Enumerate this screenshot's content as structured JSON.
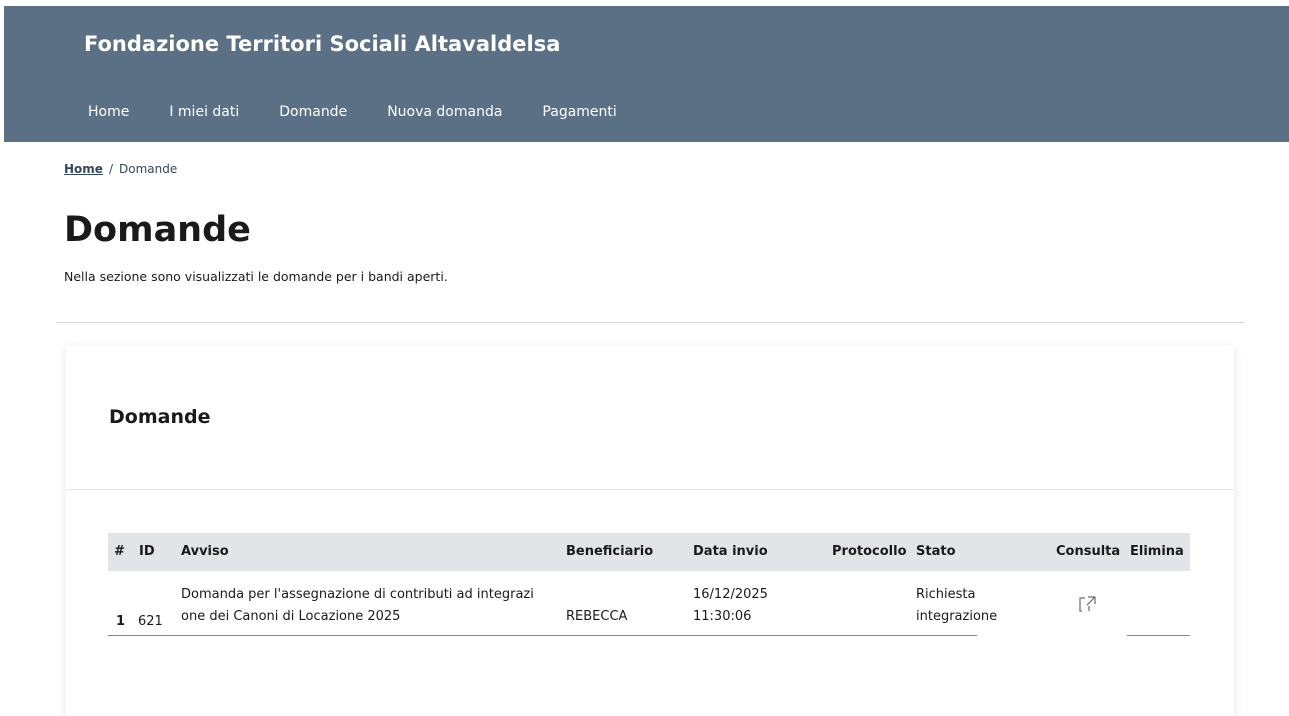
{
  "header": {
    "brand": "Fondazione Territori Sociali Altavaldelsa",
    "nav": [
      "Home",
      "I miei dati",
      "Domande",
      "Nuova domanda",
      "Pagamenti"
    ]
  },
  "breadcrumb": {
    "home": "Home",
    "separator": "/",
    "current": "Domande"
  },
  "page": {
    "title": "Domande",
    "description": "Nella sezione sono visualizzati le domande per i bandi aperti."
  },
  "card": {
    "title": "Domande",
    "columns": [
      "#",
      "ID",
      "Avviso",
      "Beneficiario",
      "Data invio",
      "Protocollo",
      "Stato",
      "Consulta",
      "Elimina"
    ],
    "rows": [
      {
        "num": "1",
        "id": "621",
        "avviso_line1": "Domanda per l'assegnazione di contributi ad integrazi",
        "avviso_line2": "one dei Canoni di Locazione 2025",
        "beneficiario": "REBECCA",
        "data_line1": "16/12/2025",
        "data_line2": "11:30:06",
        "protocollo": "",
        "stato_line1": "Richiesta",
        "stato_line2": "integrazione"
      }
    ]
  },
  "icons": {
    "consulta": "external-link-icon"
  },
  "colors": {
    "header_bg": "#5c7085",
    "table_head_bg": "#e2e4e8"
  }
}
